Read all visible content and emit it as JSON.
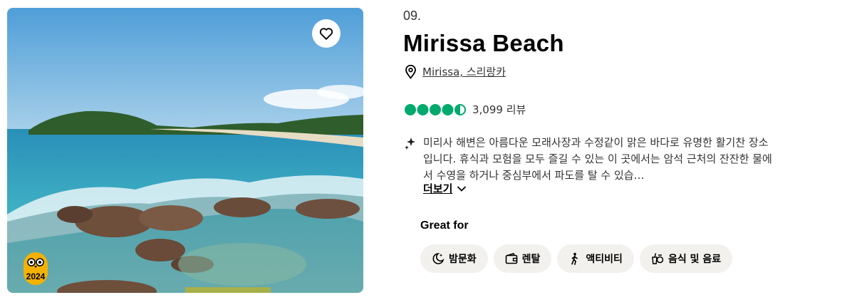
{
  "item": {
    "rank": "09.",
    "title": "Mirissa Beach",
    "location": "Mirissa, 스리랑카",
    "rating": 4.5,
    "reviews": "3,099 리뷰",
    "description": "미리사 해변은 아름다운 모래사장과 수정같이 맑은 바다로 유명한 활기찬 장소입니다. 휴식과 모험을 모두 즐길 수 있는 이 곳에서는 암석 근처의 잔잔한 물에서 수영을 하거나 중심부에서 파도를 탈 수 있습…",
    "more_label": "더보기",
    "award_year": "2024",
    "great_for_label": "Great for",
    "tags": [
      {
        "label": "밤문화",
        "icon": "moon-star-icon"
      },
      {
        "label": "렌탈",
        "icon": "wallet-icon"
      },
      {
        "label": "액티비티",
        "icon": "hiking-icon"
      },
      {
        "label": "음식 및 음료",
        "icon": "food-drink-icon"
      }
    ]
  },
  "colors": {
    "bubble": "#00aa6c",
    "badge": "#f5b100",
    "tag_bg": "#f2f1ee"
  }
}
